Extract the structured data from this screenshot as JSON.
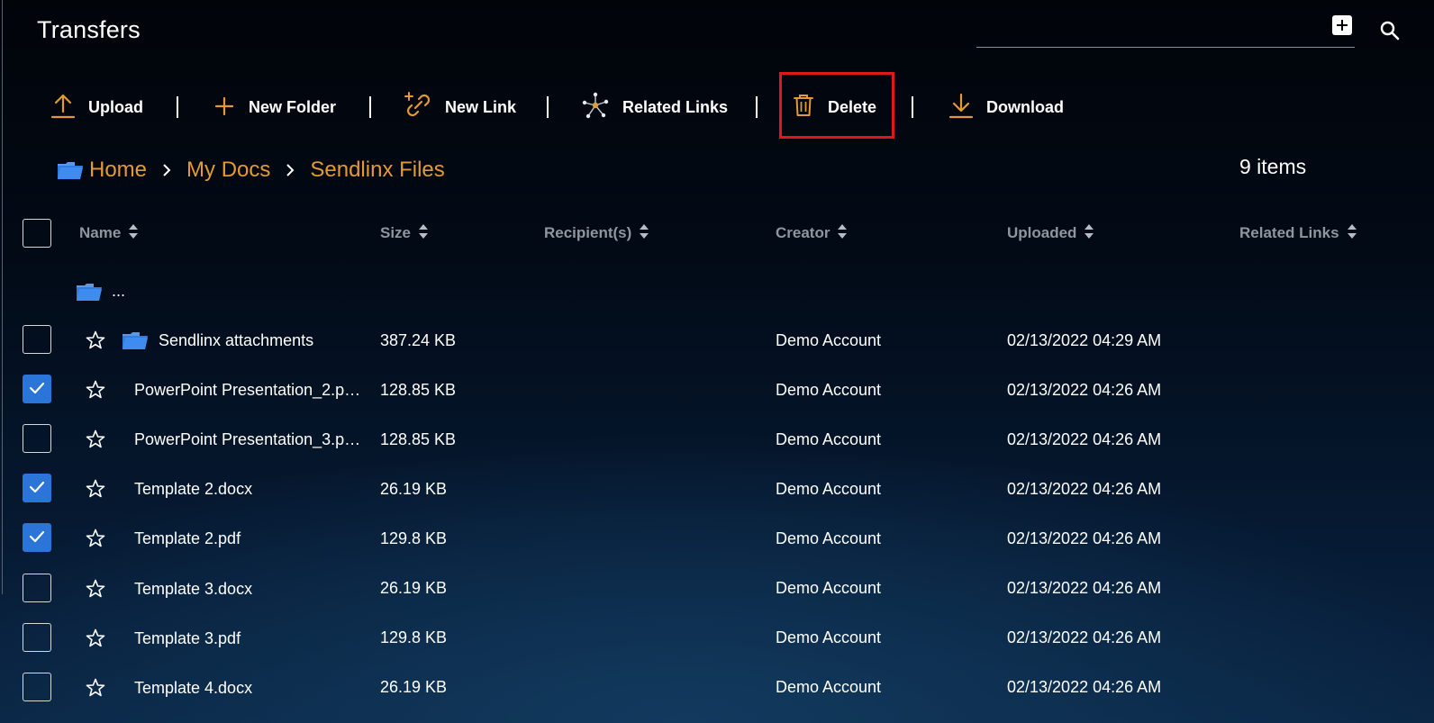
{
  "header": {
    "title": "Transfers",
    "search_placeholder": "",
    "add_icon": "plus-square-icon",
    "search_icon": "search-icon"
  },
  "toolbar": {
    "upload": "Upload",
    "new_folder": "New Folder",
    "new_link": "New Link",
    "related_links": "Related Links",
    "delete": "Delete",
    "download": "Download"
  },
  "breadcrumb": {
    "items": [
      "Home",
      "My Docs",
      "Sendlinx Files"
    ]
  },
  "item_count": "9 items",
  "table": {
    "columns": [
      "Name",
      "Size",
      "Recipient(s)",
      "Creator",
      "Uploaded",
      "Related Links"
    ],
    "parent_row_label": "...",
    "rows": [
      {
        "name": "Sendlinx attachments",
        "is_folder": true,
        "size": "387.24 KB",
        "recipients": "",
        "creator": "Demo Account",
        "uploaded": "02/13/2022 04:29 AM",
        "checked": false
      },
      {
        "name": "PowerPoint Presentation_2.pptx",
        "is_folder": false,
        "size": "128.85 KB",
        "recipients": "",
        "creator": "Demo Account",
        "uploaded": "02/13/2022 04:26 AM",
        "checked": true
      },
      {
        "name": "PowerPoint Presentation_3.pptx",
        "is_folder": false,
        "size": "128.85 KB",
        "recipients": "",
        "creator": "Demo Account",
        "uploaded": "02/13/2022 04:26 AM",
        "checked": false
      },
      {
        "name": "Template 2.docx",
        "is_folder": false,
        "size": "26.19 KB",
        "recipients": "",
        "creator": "Demo Account",
        "uploaded": "02/13/2022 04:26 AM",
        "checked": true
      },
      {
        "name": "Template 2.pdf",
        "is_folder": false,
        "size": "129.8 KB",
        "recipients": "",
        "creator": "Demo Account",
        "uploaded": "02/13/2022 04:26 AM",
        "checked": true
      },
      {
        "name": "Template 3.docx",
        "is_folder": false,
        "size": "26.19 KB",
        "recipients": "",
        "creator": "Demo Account",
        "uploaded": "02/13/2022 04:26 AM",
        "checked": false
      },
      {
        "name": "Template 3.pdf",
        "is_folder": false,
        "size": "129.8 KB",
        "recipients": "",
        "creator": "Demo Account",
        "uploaded": "02/13/2022 04:26 AM",
        "checked": false
      },
      {
        "name": "Template 4.docx",
        "is_folder": false,
        "size": "26.19 KB",
        "recipients": "",
        "creator": "Demo Account",
        "uploaded": "02/13/2022 04:26 AM",
        "checked": false
      }
    ]
  },
  "colors": {
    "accent_orange": "#e39a34",
    "checkbox_blue": "#2b74d8",
    "folder_blue": "#2f7de1",
    "highlight_red": "#e0181b",
    "header_gray": "#8f969e"
  }
}
